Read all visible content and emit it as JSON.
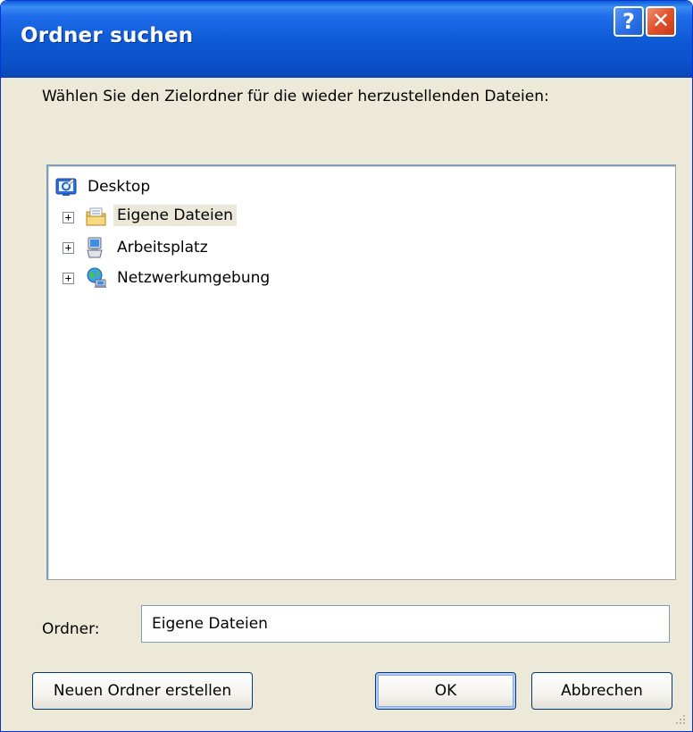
{
  "window": {
    "title": "Ordner suchen",
    "help_glyph": "?",
    "close_glyph": "✕"
  },
  "instruction": "Wählen Sie den Zielordner für die wieder herzustellenden Dateien:",
  "tree": {
    "root": {
      "label": "Desktop",
      "icon": "desktop-icon"
    },
    "items": [
      {
        "label": "Eigene Dateien",
        "icon": "my-documents-icon",
        "expander": "+",
        "selected": true
      },
      {
        "label": "Arbeitsplatz",
        "icon": "my-computer-icon",
        "expander": "+",
        "selected": false
      },
      {
        "label": "Netzwerkumgebung",
        "icon": "network-places-icon",
        "expander": "+",
        "selected": false
      }
    ]
  },
  "folder_field": {
    "label": "Ordner:",
    "value": "Eigene Dateien"
  },
  "buttons": {
    "new_folder": "Neuen Ordner erstellen",
    "ok": "OK",
    "cancel": "Abbrechen"
  },
  "colors": {
    "titlebar": "#0b4fc8",
    "dialog_bg": "#ece9d8",
    "selection_bg": "#ebe8d9",
    "close_button": "#e0522c"
  }
}
